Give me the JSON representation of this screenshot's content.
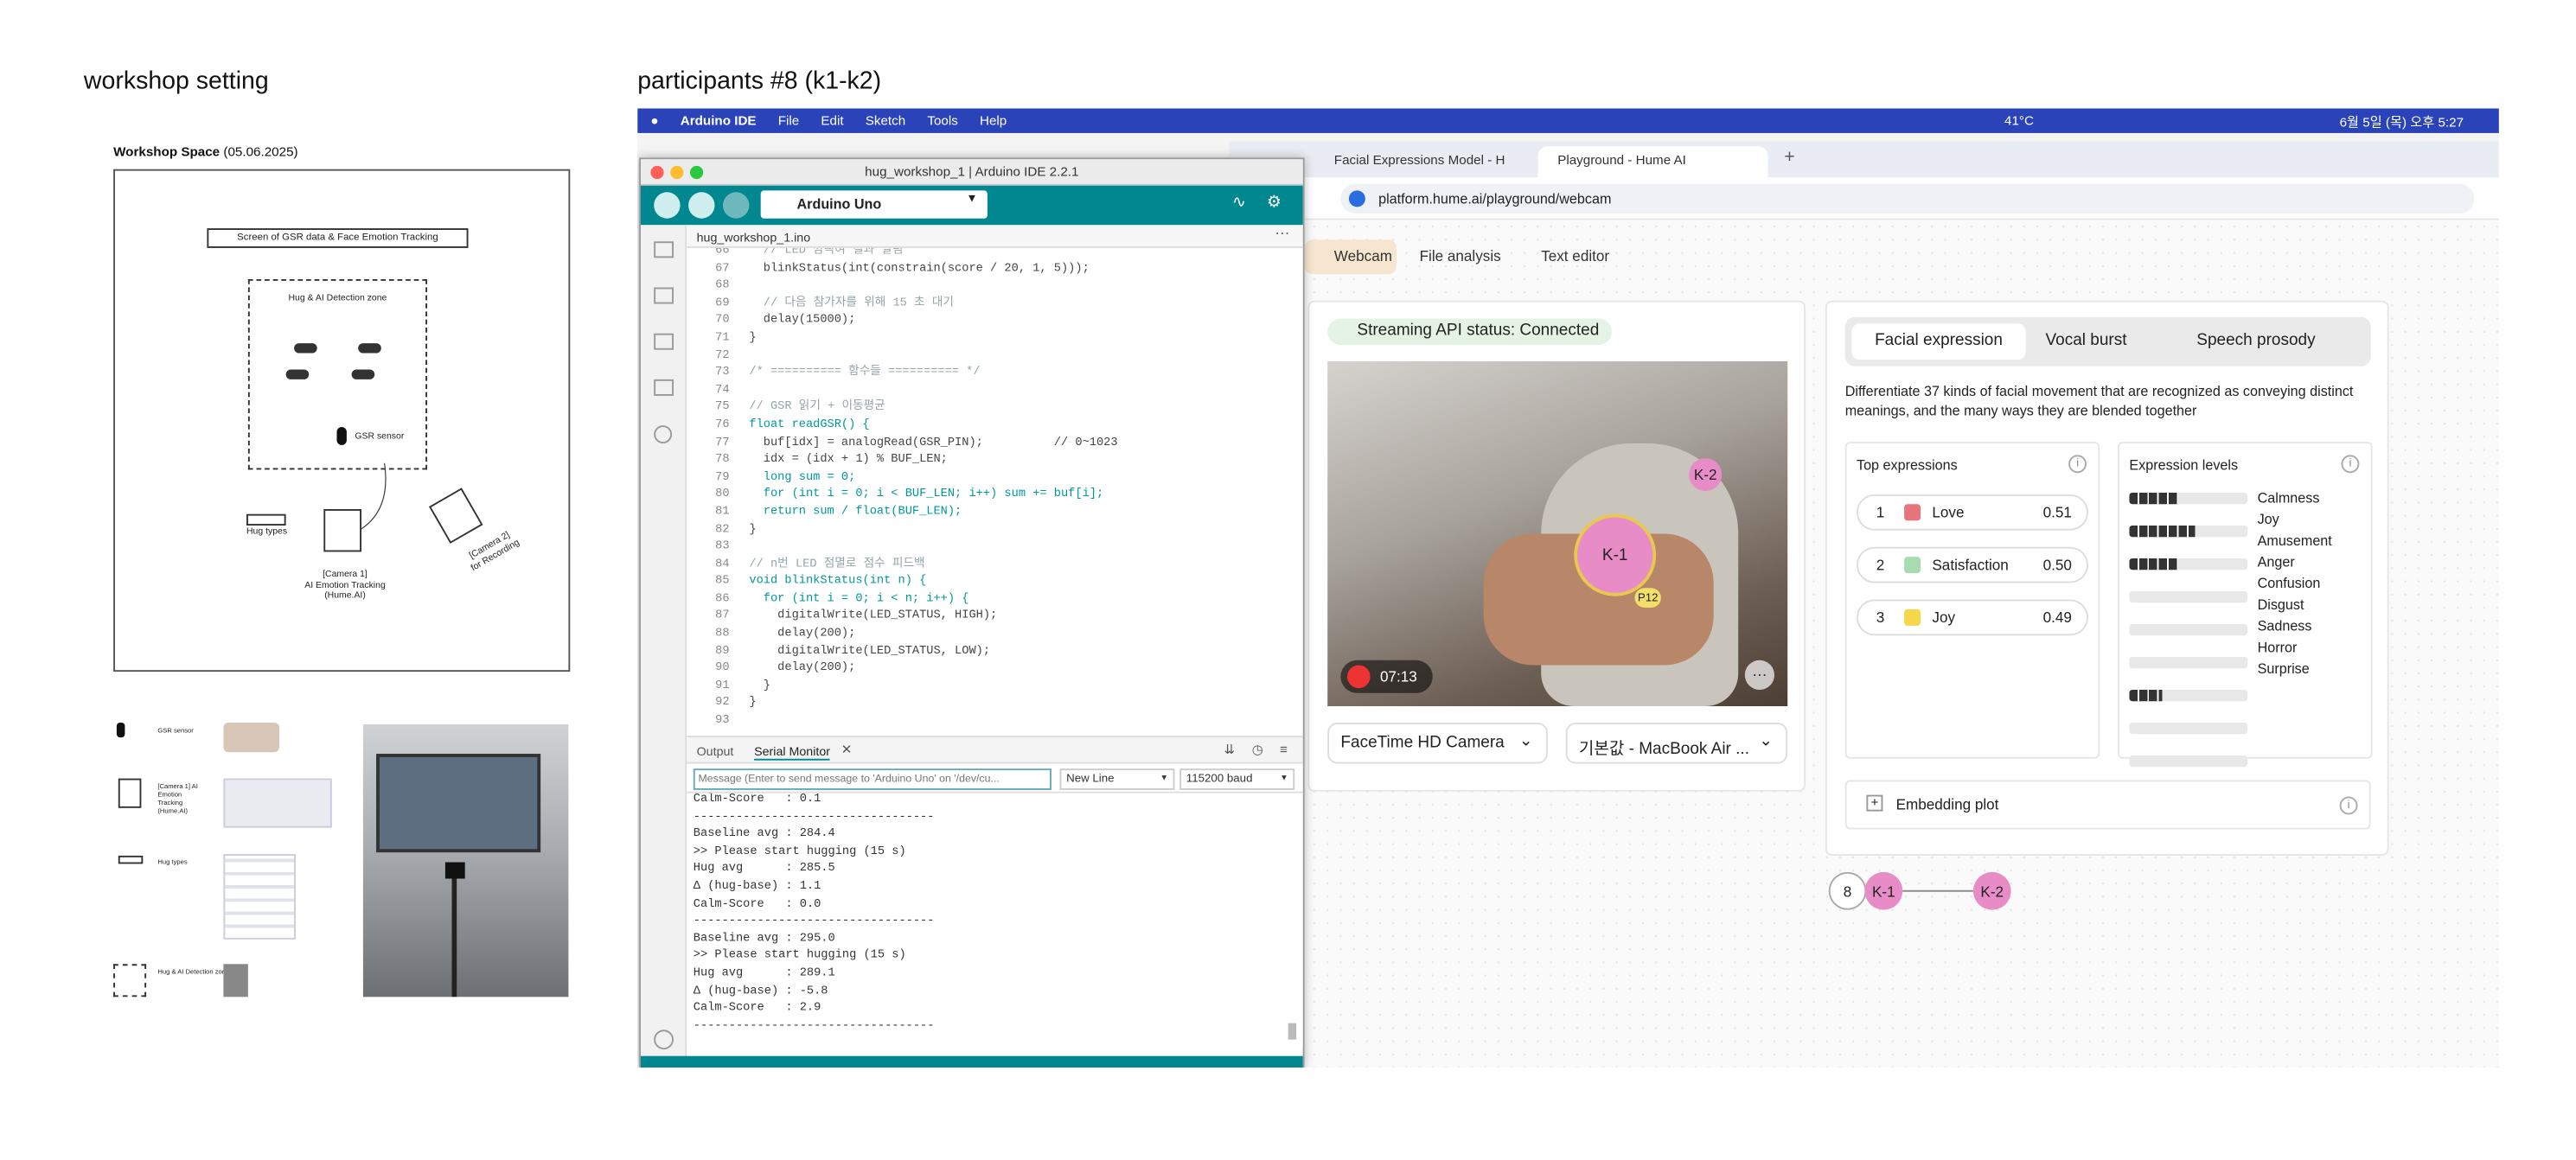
{
  "left": {
    "heading": "workshop setting",
    "space_title": "Workshop Space",
    "space_date": "(05.06.2025)",
    "screen_label": "Screen of GSR data & Face Emotion Tracking",
    "zone_label": "Hug & AI Detection zone",
    "gsr_label": "GSR sensor",
    "hug_types_label": "Hug types",
    "camera1_label": "[Camera 1]",
    "camera1_desc": "AI Emotion Tracking",
    "camera1_desc2": "(Hume.AI)",
    "camera2_label": "[Camera 2]",
    "camera2_desc": "for Recording",
    "legend": [
      {
        "label": "GSR sensor"
      },
      {
        "label": "[Camera 1] AI Emotion Tracking (Hume.AI)"
      },
      {
        "label": "Hug types"
      },
      {
        "label": "Hug & AI Detection zone"
      }
    ]
  },
  "right_heading": "participants #8 (k1-k2)",
  "menubar": {
    "app": "Arduino IDE",
    "items": [
      "File",
      "Edit",
      "Sketch",
      "Tools",
      "Help"
    ],
    "temp": "41°C",
    "datetime": "6월 5일 (목) 오후 5:27"
  },
  "arduino": {
    "title": "hug_workshop_1 | Arduino IDE 2.2.1",
    "board": "Arduino Uno",
    "file_tab": "hug_workshop_1.ino",
    "line_numbers": [
      "66",
      "67",
      "68",
      "69",
      "70",
      "71",
      "72",
      "73",
      "74",
      "75",
      "76",
      "77",
      "78",
      "79",
      "80",
      "81",
      "82",
      "83",
      "84",
      "85",
      "86",
      "87",
      "88",
      "89",
      "90",
      "91",
      "92",
      "93"
    ],
    "code": [
      "  // LED 깜빡여 결과 알림",
      "  blinkStatus(int(constrain(score / 20, 1, 5)));",
      "",
      "  // 다음 참가자를 위해 15 초 대기",
      "  delay(15000);",
      "}",
      "",
      "/* ========== 함수들 ========== */",
      "",
      "// GSR 읽기 + 이동평균",
      "float readGSR() {",
      "  buf[idx] = analogRead(GSR_PIN);          // 0~1023",
      "  idx = (idx + 1) % BUF_LEN;",
      "  long sum = 0;",
      "  for (int i = 0; i < BUF_LEN; i++) sum += buf[i];",
      "  return sum / float(BUF_LEN);",
      "}",
      "",
      "// n번 LED 점멸로 점수 피드백",
      "void blinkStatus(int n) {",
      "  for (int i = 0; i < n; i++) {",
      "    digitalWrite(LED_STATUS, HIGH);",
      "    delay(200);",
      "    digitalWrite(LED_STATUS, LOW);",
      "    delay(200);",
      "  }",
      "}",
      ""
    ],
    "tab_output": "Output",
    "tab_serial": "Serial Monitor",
    "serial_placeholder": "Message (Enter to send message to 'Arduino Uno' on '/dev/cu...",
    "line_ending": "New Line",
    "baud": "115200 baud",
    "serial_lines": [
      "Calm-Score   : 0.1",
      "----------------------------------",
      "Baseline avg : 284.4",
      ">> Please start hugging (15 s)",
      "Hug avg      : 285.5",
      "Δ (hug-base) : 1.1",
      "Calm-Score   : 0.0",
      "----------------------------------",
      "Baseline avg : 295.0",
      ">> Please start hugging (15 s)",
      "Hug avg      : 289.1",
      "Δ (hug-base) : -5.8",
      "Calm-Score   : 2.9",
      "----------------------------------"
    ]
  },
  "browser": {
    "tabs": [
      "Facial Expressions Model - H",
      "Playground - Hume AI"
    ],
    "url": "platform.hume.ai/playground/webcam",
    "modes": [
      "Webcam",
      "File analysis",
      "Text editor"
    ],
    "status": "Streaming API status: Connected",
    "timer": "07:13",
    "k1": "K-1",
    "k2": "K-2",
    "p12": "P12",
    "camera_select": "FaceTime HD Camera",
    "mic_select": "기본값 - MacBook Air ...",
    "expr_tabs": [
      "Facial expression",
      "Vocal burst",
      "Speech prosody"
    ],
    "description": "Differentiate 37 kinds of facial movement that are recognized as conveying distinct meanings, and the many ways they are blended together",
    "top_title": "Top expressions",
    "top": [
      {
        "rank": "1",
        "name": "Love",
        "score": "0.51",
        "color": "#e8747c"
      },
      {
        "rank": "2",
        "name": "Satisfaction",
        "score": "0.50",
        "color": "#a8dcb0"
      },
      {
        "rank": "3",
        "name": "Joy",
        "score": "0.49",
        "color": "#f5d84a"
      }
    ],
    "levels_title": "Expression levels",
    "levels": [
      {
        "name": "Calmness",
        "value": 0.42
      },
      {
        "name": "Joy",
        "value": 0.56
      },
      {
        "name": "Amusement",
        "value": 0.42
      },
      {
        "name": "Anger",
        "value": 0
      },
      {
        "name": "Confusion",
        "value": 0
      },
      {
        "name": "Disgust",
        "value": 0
      },
      {
        "name": "Sadness",
        "value": 0.28
      },
      {
        "name": "Horror",
        "value": 0
      },
      {
        "name": "Surprise",
        "value": 0
      }
    ],
    "embedding": "Embedding plot"
  },
  "diagram": {
    "n": "8",
    "a": "K-1",
    "b": "K-2"
  },
  "colors": {
    "menubar": "#2a43b8",
    "arduino_teal": "#00878f",
    "pink": "#e78cc7",
    "hume_bg": "#fafafa"
  }
}
